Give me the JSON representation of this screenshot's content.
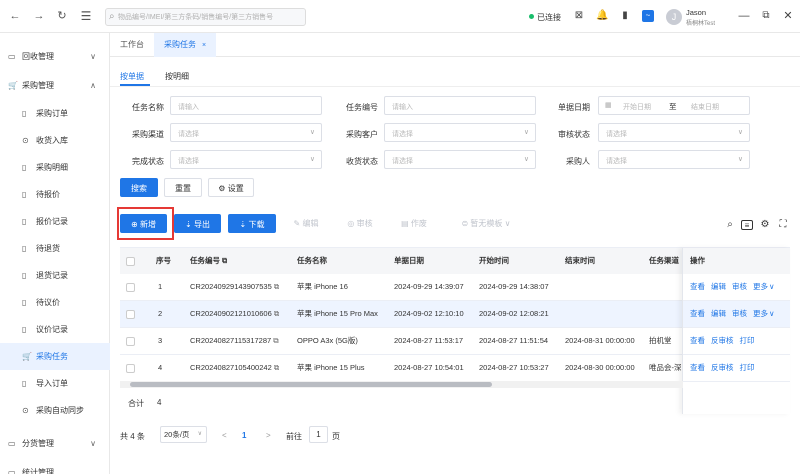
{
  "topbar": {
    "search_placeholder": "物品编号/IMEI/第三方条码/销售编号/第三方销售号",
    "connection_status": "已连接",
    "user_name": "Jason",
    "user_org": "梧桐林Test",
    "avatar_letter": "J"
  },
  "sidebar": {
    "items": [
      {
        "label": "回收管理",
        "icon": "▭",
        "chevron": "∨"
      },
      {
        "label": "采购管理",
        "icon": "🛒",
        "chevron": "∧"
      },
      {
        "label": "采购订单",
        "icon": "▯"
      },
      {
        "label": "收货入库",
        "icon": "⊙"
      },
      {
        "label": "采购明细",
        "icon": "▯"
      },
      {
        "label": "待报价",
        "icon": "▯"
      },
      {
        "label": "报价记录",
        "icon": "▯"
      },
      {
        "label": "待退货",
        "icon": "▯"
      },
      {
        "label": "退货记录",
        "icon": "▯"
      },
      {
        "label": "待议价",
        "icon": "▯"
      },
      {
        "label": "议价记录",
        "icon": "▯"
      },
      {
        "label": "采购任务",
        "icon": "🛒"
      },
      {
        "label": "导入订单",
        "icon": "▯"
      },
      {
        "label": "采购自动同步",
        "icon": "⊙"
      },
      {
        "label": "分货管理",
        "icon": "▭",
        "chevron": "∨"
      },
      {
        "label": "统计管理",
        "icon": "▭"
      }
    ]
  },
  "page_tabs": {
    "workbench": "工作台",
    "purchase_task": "采购任务",
    "close": "×"
  },
  "subtabs": {
    "by_order": "按单据",
    "by_detail": "按明细"
  },
  "filters": {
    "task_name": {
      "label": "任务名称",
      "placeholder": "请输入"
    },
    "task_no": {
      "label": "任务编号",
      "placeholder": "请输入"
    },
    "doc_date": {
      "label": "单据日期",
      "start": "开始日期",
      "to": "至",
      "end": "结束日期"
    },
    "channel": {
      "label": "采购渠道",
      "placeholder": "请选择"
    },
    "customer": {
      "label": "采购客户",
      "placeholder": "请选择"
    },
    "review_status": {
      "label": "审核状态",
      "placeholder": "请选择"
    },
    "complete_status": {
      "label": "完成状态",
      "placeholder": "请选择"
    },
    "receive_status": {
      "label": "收货状态",
      "placeholder": "请选择"
    },
    "buyer": {
      "label": "采购人",
      "placeholder": "请选择"
    }
  },
  "actions": {
    "search": "搜索",
    "reset": "重置",
    "settings": "设置",
    "add": "新增",
    "export": "导出",
    "download": "下载",
    "edit": "编辑",
    "review": "审核",
    "void": "作废",
    "no_template": "暂无模板"
  },
  "table": {
    "headers": {
      "seq": "序号",
      "task_no": "任务编号",
      "task_name": "任务名称",
      "doc_date": "单据日期",
      "start_time": "开始时间",
      "end_time": "结束时间",
      "channel": "任务渠道",
      "ops": "操作"
    },
    "rows": [
      {
        "seq": "1",
        "task_no": "CR20240929143907535",
        "task_name": "苹果 iPhone 16",
        "doc_date": "2024-09-29 14:39:07",
        "start_time": "2024-09-29 14:38:07",
        "end_time": "",
        "channel": "",
        "ops": [
          "查看",
          "编辑",
          "审核",
          "更多"
        ]
      },
      {
        "seq": "2",
        "task_no": "CR20240902121010606",
        "task_name": "苹果 iPhone 15 Pro Max",
        "doc_date": "2024-09-02 12:10:10",
        "start_time": "2024-09-02 12:08:21",
        "end_time": "",
        "channel": "",
        "ops": [
          "查看",
          "编辑",
          "审核",
          "更多"
        ]
      },
      {
        "seq": "3",
        "task_no": "CR20240827115317287",
        "task_name": "OPPO A3x (5G版)",
        "doc_date": "2024-08-27 11:53:17",
        "start_time": "2024-08-27 11:51:54",
        "end_time": "2024-08-31 00:00:00",
        "channel": "拍机堂",
        "ops": [
          "查看",
          "反审核",
          "打印"
        ]
      },
      {
        "seq": "4",
        "task_no": "CR20240827105400242",
        "task_name": "苹果 iPhone 15 Plus",
        "doc_date": "2024-08-27 10:54:01",
        "start_time": "2024-08-27 10:53:27",
        "end_time": "2024-08-30 00:00:00",
        "channel": "唯品会-深",
        "ops": [
          "查看",
          "反审核",
          "打印"
        ]
      }
    ],
    "summary_label": "合计",
    "summary_value": "4"
  },
  "pagination": {
    "total": "共 4 条",
    "page_size": "20条/页",
    "prev": "<",
    "current": "1",
    "next": ">",
    "goto": "前往",
    "goto_value": "1",
    "page_unit": "页"
  },
  "colors": {
    "accent": "#1f76e6",
    "highlight": "#e53935",
    "connected": "#19be6b"
  }
}
